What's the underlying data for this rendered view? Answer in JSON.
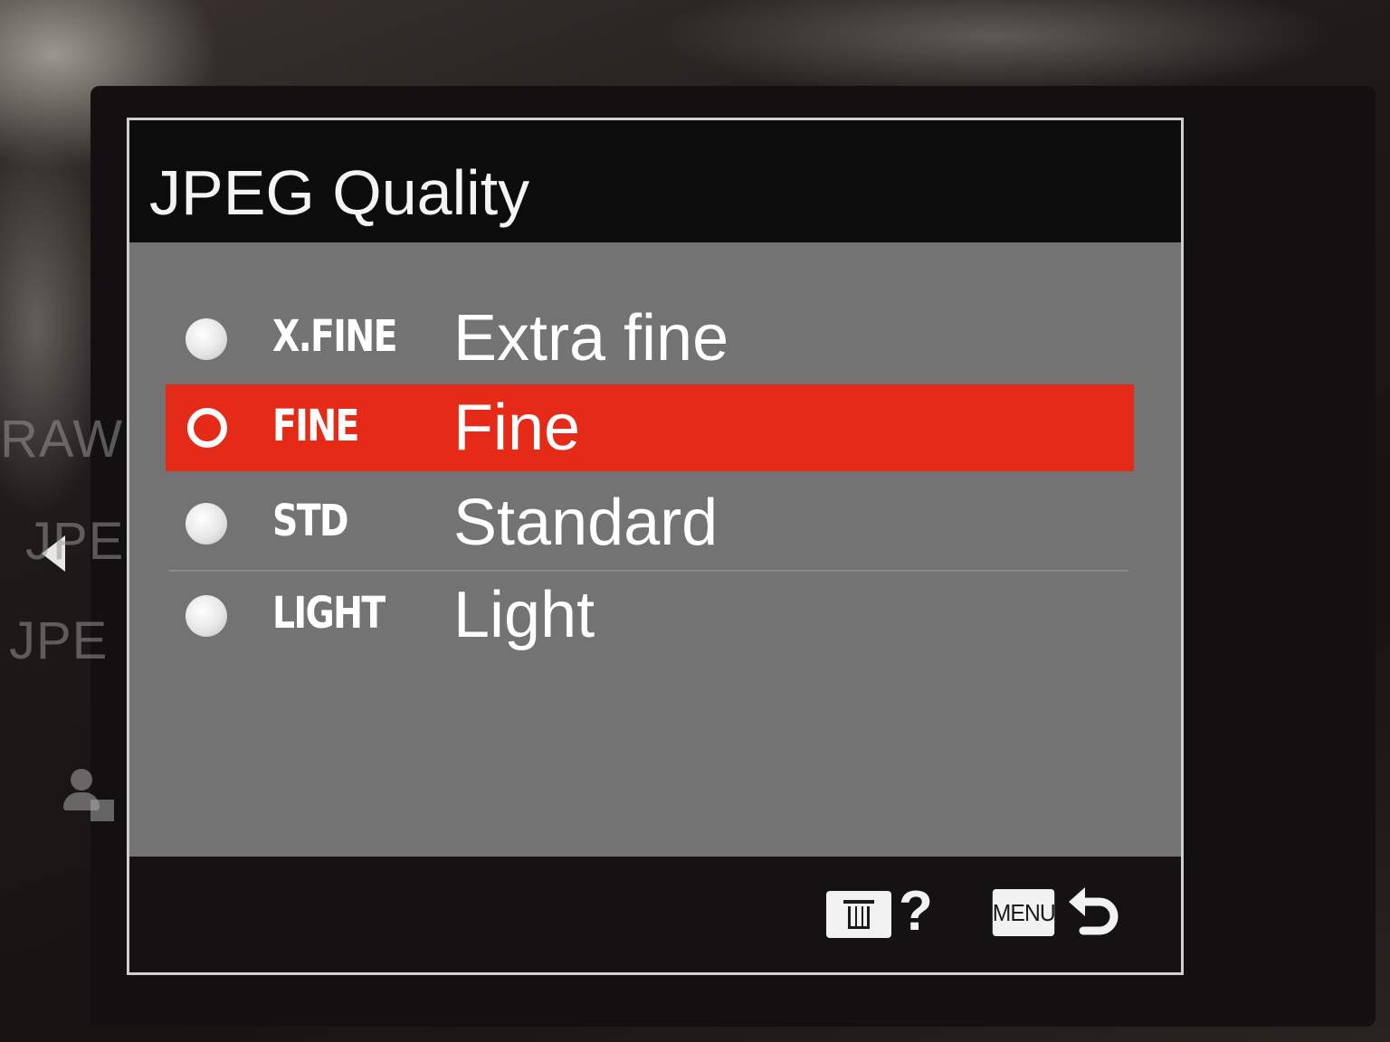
{
  "background": {
    "left_labels": [
      "RAW",
      "JPE",
      "JPE"
    ]
  },
  "menu": {
    "title": "JPEG Quality",
    "options": [
      {
        "abbr": "X.FINE",
        "label": "Extra fine",
        "selected": false
      },
      {
        "abbr": "FINE",
        "label": "Fine",
        "selected": true
      },
      {
        "abbr": "STD",
        "label": "Standard",
        "selected": false
      },
      {
        "abbr": "LIGHT",
        "label": "Light",
        "selected": false
      }
    ]
  },
  "footer": {
    "help_glyph": "?",
    "menu_key_label": "MENU",
    "icons": [
      "trash-icon",
      "back-arrow-icon"
    ]
  },
  "colors": {
    "highlight": "#e52a18",
    "panel_bg": "#737374",
    "header_bg": "#0c0c0c"
  }
}
